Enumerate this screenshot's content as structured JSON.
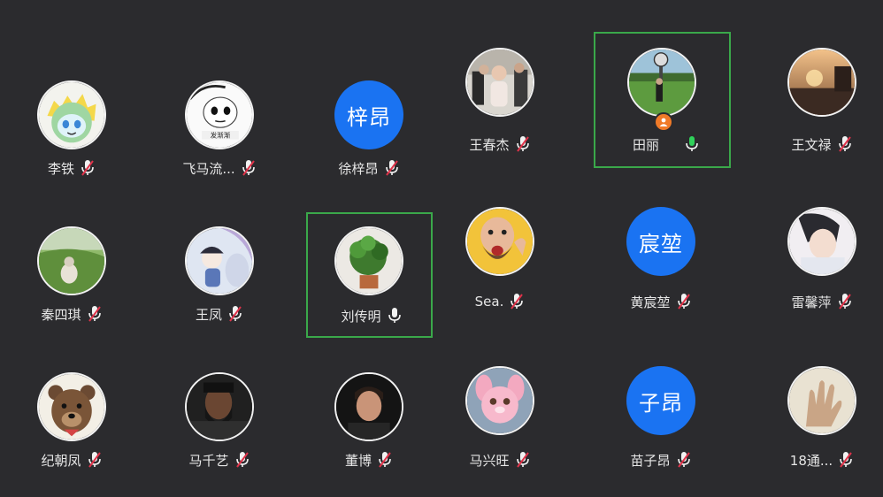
{
  "participants": [
    {
      "name": "李铁",
      "mic": "muted",
      "avatar": "photo"
    },
    {
      "name": "飞马流...",
      "mic": "muted",
      "avatar": "photo"
    },
    {
      "name": "徐梓昂",
      "mic": "muted",
      "avatar": "text",
      "avatar_text": "梓昂"
    },
    {
      "name": "王春杰",
      "mic": "muted",
      "avatar": "photo"
    },
    {
      "name": "田丽",
      "mic": "active",
      "avatar": "photo",
      "host": true
    },
    {
      "name": "王文禄",
      "mic": "muted",
      "avatar": "photo"
    },
    {
      "name": "秦四琪",
      "mic": "muted",
      "avatar": "photo"
    },
    {
      "name": "王凤",
      "mic": "muted",
      "avatar": "photo"
    },
    {
      "name": "刘传明",
      "mic": "active",
      "avatar": "photo"
    },
    {
      "name": "Sea.",
      "mic": "muted",
      "avatar": "photo"
    },
    {
      "name": "黄宸堃",
      "mic": "muted",
      "avatar": "text",
      "avatar_text": "宸堃"
    },
    {
      "name": "雷馨萍",
      "mic": "muted",
      "avatar": "photo"
    },
    {
      "name": "纪朝凤",
      "mic": "muted",
      "avatar": "photo"
    },
    {
      "name": "马千艺",
      "mic": "muted",
      "avatar": "photo"
    },
    {
      "name": "董博",
      "mic": "muted",
      "avatar": "photo"
    },
    {
      "name": "马兴旺",
      "mic": "muted",
      "avatar": "photo"
    },
    {
      "name": "苗子昂",
      "mic": "muted",
      "avatar": "text",
      "avatar_text": "子昂"
    },
    {
      "name": "18通...",
      "mic": "muted",
      "avatar": "photo"
    }
  ],
  "icons": {
    "mic_muted": "mic-off-icon",
    "mic_active": "mic-icon",
    "host": "host-person-icon"
  },
  "colors": {
    "background": "#2b2b2e",
    "speaking_border": "#3aa84a",
    "text_avatar": "#1a73f2",
    "mic_muted_slash": "#e0334a",
    "host_badge": "#f07a28"
  }
}
